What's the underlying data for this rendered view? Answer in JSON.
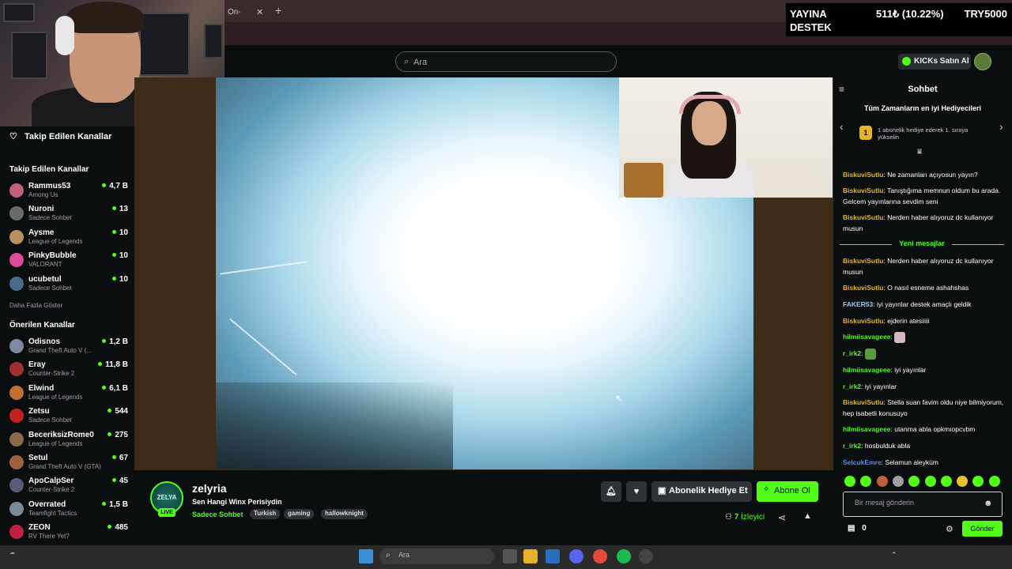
{
  "browser": {
    "tab_label": "On-",
    "tab_close": "✕",
    "new_tab": "+"
  },
  "donation_overlay": {
    "line1": "YAYINA",
    "line2": "DESTEK",
    "amount": "511₺ (10.22%)",
    "goal": "TRY5000",
    "progress_percent": 10.22
  },
  "header": {
    "search_placeholder": "Ara",
    "kicks_label": "KICKs Satın Al"
  },
  "sidebar": {
    "header": "Takip Edilen Kanallar",
    "followed_title": "Takip Edilen Kanallar",
    "followed": [
      {
        "name": "Rammus53",
        "category": "Among Us",
        "viewers": "4,7 B",
        "color": "#c0607a"
      },
      {
        "name": "Nuroni",
        "category": "Sadece Sohbet",
        "viewers": "13",
        "color": "#6a6a6a"
      },
      {
        "name": "Aysme",
        "category": "League of Legends",
        "viewers": "10",
        "color": "#b89060"
      },
      {
        "name": "PinkyBubble",
        "category": "VALORANT",
        "viewers": "10",
        "color": "#e04a9a"
      },
      {
        "name": "ucubetul",
        "category": "Sadece Sohbet",
        "viewers": "10",
        "color": "#4a6a8a"
      }
    ],
    "show_more": "Daha Fazla Göster",
    "recommended_title": "Önerilen Kanallar",
    "recommended": [
      {
        "name": "Odisnos",
        "category": "Grand Theft Auto V (...",
        "viewers": "1,2 B",
        "color": "#7a8aa0"
      },
      {
        "name": "Eray",
        "category": "Counter-Strike 2",
        "viewers": "11,8 B",
        "color": "#a03030"
      },
      {
        "name": "Elwind",
        "category": "League of Legends",
        "viewers": "6,1 B",
        "color": "#c07030"
      },
      {
        "name": "Zetsu",
        "category": "Sadece Sohbet",
        "viewers": "544",
        "color": "#c02020"
      },
      {
        "name": "BeceriksizRome0",
        "category": "League of Legends",
        "viewers": "275",
        "color": "#8a6a4a"
      },
      {
        "name": "Setul",
        "category": "Grand Theft Auto V (GTA)",
        "viewers": "67",
        "color": "#a06040"
      },
      {
        "name": "ApoCalpSer",
        "category": "Counter-Strike 2",
        "viewers": "45",
        "color": "#5a5a7a"
      },
      {
        "name": "Overrated",
        "category": "Teamfight Tactics",
        "viewers": "1,5 B",
        "color": "#7a8a9a"
      },
      {
        "name": "ZEON",
        "category": "RV There Yet?",
        "viewers": "485",
        "color": "#c02040"
      }
    ]
  },
  "stream": {
    "avatar_text": "ZELYA",
    "live_badge": "LIVE",
    "name": "zelyria",
    "title": "Sen Hangi Winx Perisiydin",
    "category": "Sadece Sohbet",
    "tags": [
      "Turkish",
      "gaming",
      "hallowknight"
    ],
    "gift_sub_label": "Abonelik Hediye Et",
    "subscribe_label": "Abone Ol",
    "viewer_count": "7",
    "viewer_label": "İzleyici"
  },
  "chat": {
    "title": "Sohbet",
    "gifters_title": "Tüm Zamanların en iyi Hediyecileri",
    "gifter_rank": "1",
    "gifter_text": "1 abonelik hediye ederek 1. sıraya yükselin",
    "new_messages_label": "Yeni mesajlar",
    "messages_before": [
      {
        "user": "BiskuviSutlu",
        "color": "#e5b32a",
        "text": "Ne zamanları açıyosun yayın?"
      },
      {
        "user": "BiskuviSutlu",
        "color": "#e5b32a",
        "text": "Tanıştığıma memnun oldum bu arada. Gelcem yayınlarına sevdim seni"
      },
      {
        "user": "BiskuviSutlu",
        "color": "#e5b32a",
        "text": "Nerden haber alıyoruz dc kullanıyor musun"
      }
    ],
    "messages_after": [
      {
        "user": "BiskuviSutlu",
        "color": "#e5b32a",
        "text": "Nerden haber alıyoruz dc kullanıyor musun"
      },
      {
        "user": "BiskuviSutlu",
        "color": "#e5b32a",
        "text": "O nasıl esneme ashahshas"
      },
      {
        "user": "FAKER53",
        "color": "#9ec8f0",
        "text": "iyi yayınlar destek amaçlı geldik"
      },
      {
        "user": "BiskuviSutlu",
        "color": "#e5b32a",
        "text": "ejderin atesiiiii"
      },
      {
        "user": "hilmiisavageee",
        "color": "#53fc18",
        "text": ""
      },
      {
        "user": "r_irk2",
        "color": "#53fc18",
        "text": ""
      },
      {
        "user": "hilmiisavageee",
        "color": "#53fc18",
        "text": "iyi yayınlar"
      },
      {
        "user": "r_irk2",
        "color": "#53fc18",
        "text": "iyi yayınlar"
      },
      {
        "user": "BiskuviSutlu",
        "color": "#e5b32a",
        "text": "Stella suan favim oldu niye bilmiyorum, hep isabetli konusuyo"
      },
      {
        "user": "hilmiisavageee",
        "color": "#53fc18",
        "text": "utanma abla opkmıopcvbm"
      },
      {
        "user": "r_irk2",
        "color": "#53fc18",
        "text": "hosbulduk abla"
      },
      {
        "user": "SelcukEmre",
        "color": "#5a8ef0",
        "text": "Selamun aleyküm"
      }
    ],
    "input_placeholder": "Bir mesaj gönderin",
    "points": "0",
    "send_label": "Gönder"
  },
  "taskbar": {
    "search_placeholder": "Ara"
  }
}
